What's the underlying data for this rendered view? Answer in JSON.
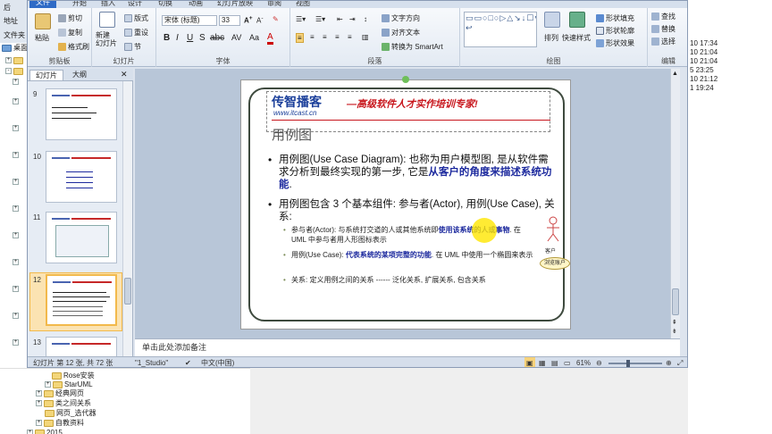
{
  "explorer": {
    "top_labels": [
      "后",
      "地址",
      "文件夹"
    ],
    "tree": [
      {
        "label": "桌面"
      },
      {
        "label": "Rose安装"
      },
      {
        "label": "StarUML"
      },
      {
        "label": "经典网页"
      },
      {
        "label": "类之间关系"
      },
      {
        "label": "网页_选代器"
      },
      {
        "label": "自教资料"
      },
      {
        "label": "2015"
      }
    ],
    "timestamps": [
      "10 17:34",
      "10 21:04",
      "10 21:04",
      "5 23:25",
      "10 21:12",
      "1 19:24"
    ]
  },
  "ppt": {
    "tabs": [
      "开始",
      "插入",
      "设计",
      "切换",
      "动画",
      "幻灯片放映",
      "审阅",
      "视图"
    ],
    "file_tab": "文件",
    "ribbon": {
      "clipboard": {
        "paste": "粘贴",
        "cut": "剪切",
        "copy": "复制",
        "format_painter": "格式刷",
        "label": "剪贴板"
      },
      "slides": {
        "new_slide": "新建\n幻灯片",
        "layout": "版式",
        "reset": "重设",
        "section": "节",
        "label": "幻灯片"
      },
      "font": {
        "family": "宋体 (标题)",
        "size": "33",
        "label": "字体"
      },
      "paragraph": {
        "text_direction": "文字方向",
        "align_text": "对齐文本",
        "smartart": "转换为 SmartArt",
        "label": "段落"
      },
      "drawing": {
        "arrange": "排列",
        "quick_styles": "快速样式",
        "fill": "形状填充",
        "outline": "形状轮廓",
        "effect": "形状效果",
        "label": "绘图"
      },
      "editing": {
        "find": "查找",
        "replace": "替换",
        "select": "选择",
        "label": "编辑"
      }
    },
    "thumb_tabs": [
      "幻灯片",
      "大纲"
    ],
    "thumbs": [
      {
        "num": "9"
      },
      {
        "num": "10"
      },
      {
        "num": "11"
      },
      {
        "num": "12"
      },
      {
        "num": "13"
      }
    ],
    "slide": {
      "logo_main": "传智播客",
      "logo_url": "www.itcast.cn",
      "slogan": "—高级软件人才实作培训专家!",
      "title": "用例图",
      "bullet1_a": "用例图(Use Case Diagram): 也称为用户模型图, 是从软件需求分析到最终实现的第一步, 它是",
      "bullet1_b": "从客户的角度来描述系统功能",
      "bullet1_c": ".",
      "bullet2": "用例图包含 3 个基本组件: 参与者(Actor), 用例(Use Case), 关系:",
      "sub1_a": "参与者(Actor): 与系统打交道的人或其他系统即",
      "sub1_b": "使用该系统的人或事物",
      "sub1_c": ". 在 UML 中参与者用人形图标表示",
      "sub2_a": "用例(Use Case): ",
      "sub2_b": "代表系统的某项完整的功能",
      "sub2_c": ". 在 UML 中使用一个椭圆来表示",
      "sub3": "关系: 定义用例之间的关系 ------ 泛化关系, 扩展关系, 包含关系",
      "actor_label": "客户",
      "usecase_label": "浏览账户"
    },
    "notes_placeholder": "单击此处添加备注",
    "status": {
      "slide_info": "幻灯片 第 12 张, 共 72 张",
      "theme": "\"1_Studio\"",
      "language": "中文(中国)",
      "zoom": "61%"
    }
  }
}
